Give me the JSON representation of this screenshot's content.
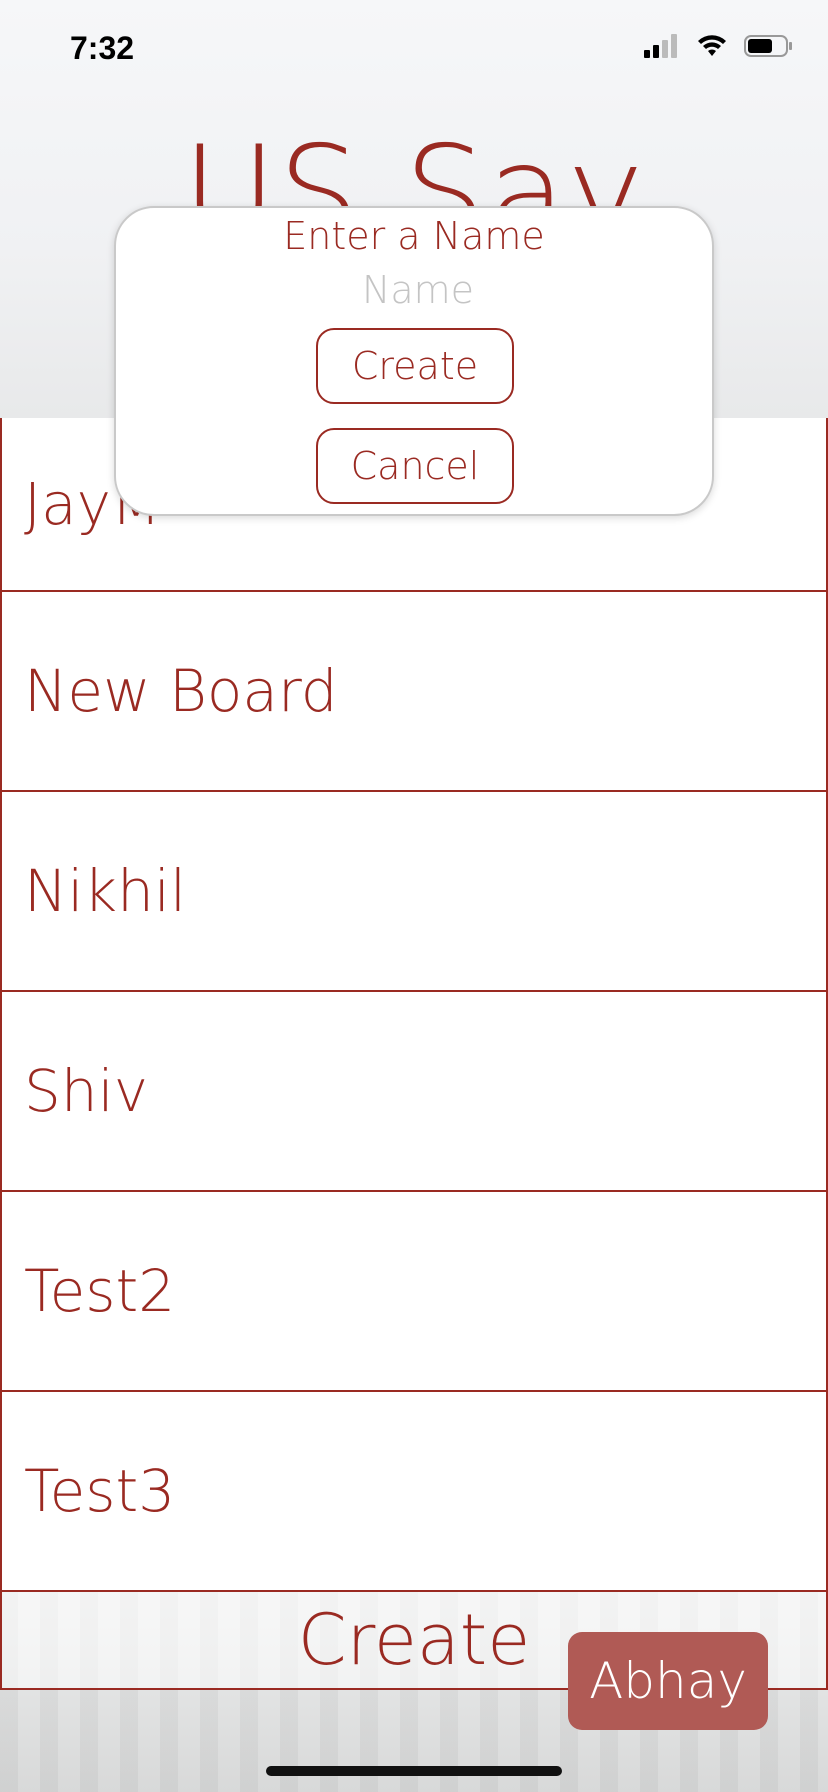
{
  "status_bar": {
    "time": "7:32"
  },
  "header": {
    "title": "US Say"
  },
  "boards": [
    {
      "label": "JayM"
    },
    {
      "label": "New Board"
    },
    {
      "label": "Nikhil"
    },
    {
      "label": "Shiv"
    },
    {
      "label": "Test2"
    },
    {
      "label": "Test3"
    }
  ],
  "footer": {
    "create_label": "Create",
    "user_label": "Abhay"
  },
  "modal": {
    "title": "Enter a Name",
    "input_placeholder": "Name",
    "input_value": "",
    "create_label": "Create",
    "cancel_label": "Cancel"
  },
  "colors": {
    "accent": "#9a2a22",
    "badge": "#b05a55"
  }
}
